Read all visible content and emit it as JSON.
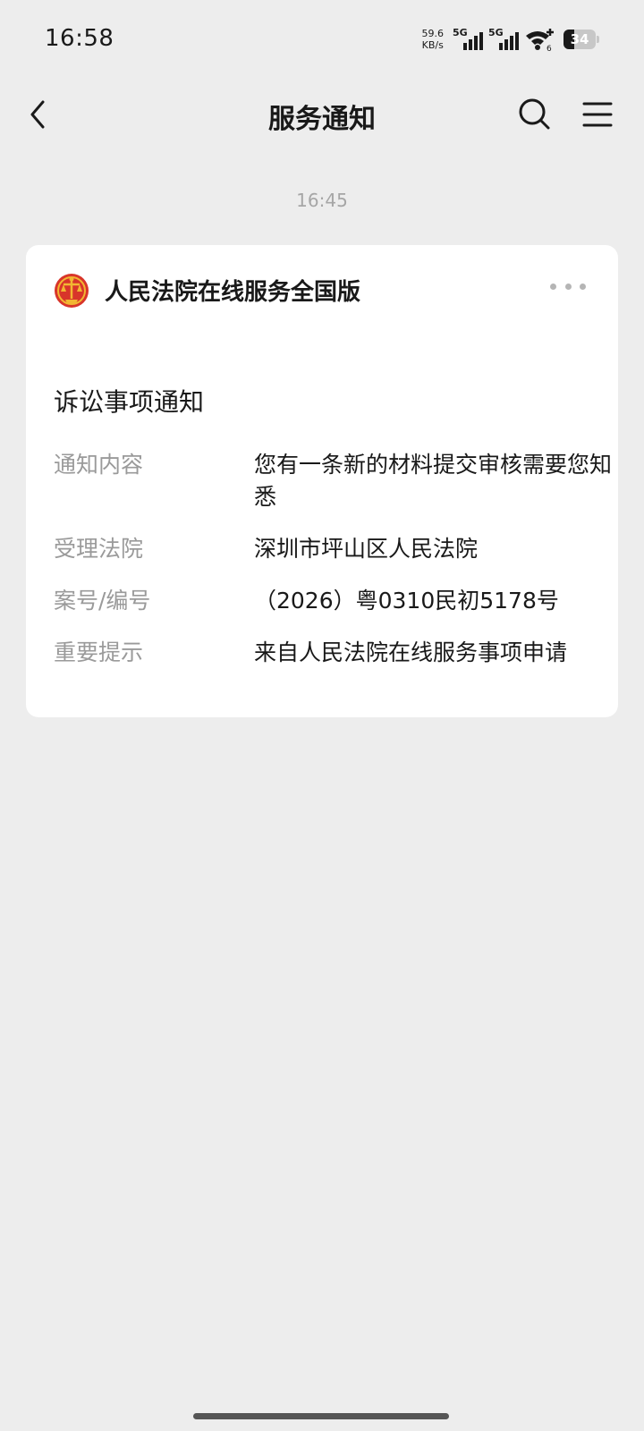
{
  "status_bar": {
    "time": "16:58",
    "net_speed_value": "59.6",
    "net_speed_unit": "KB/s",
    "signal1_label": "5G",
    "signal2_label": "5G",
    "wifi_label": "6",
    "battery_level": "34",
    "battery_fraction": 0.34,
    "wifi_icon": "wifi-icon",
    "signal_icon": "cellular-signal-icon"
  },
  "nav": {
    "title": "服务通知",
    "back_icon": "chevron-left-icon",
    "search_icon": "search-icon",
    "menu_icon": "menu-icon"
  },
  "message": {
    "time": "16:45",
    "card": {
      "account_name": "人民法院在线服务全国版",
      "logo_icon": "court-emblem-icon",
      "more_icon": "more-dots-icon",
      "title": "诉讼事项通知",
      "fields": [
        {
          "label": "通知内容",
          "value": "您有一条新的材料提交审核需要您知悉"
        },
        {
          "label": "受理法院",
          "value": "深圳市坪山区人民法院"
        },
        {
          "label": "案号/编号",
          "value": "（2026）粤0310民初5178号"
        },
        {
          "label": "重要提示",
          "value": "来自人民法院在线服务事项申请"
        }
      ]
    }
  },
  "colors": {
    "page_background": "#ededed",
    "card_background": "#ffffff",
    "label_gray": "#9a9a9a",
    "emblem_red": "#d8352a",
    "emblem_gold": "#f2b632"
  }
}
